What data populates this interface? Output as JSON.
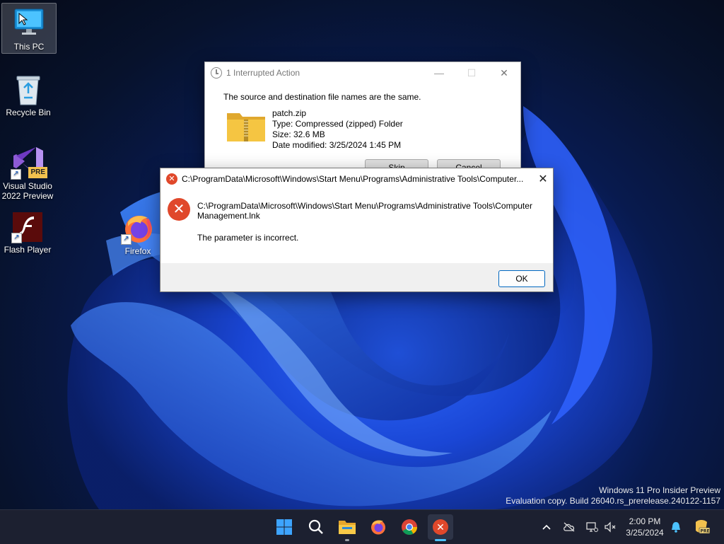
{
  "desktop": {
    "icons": [
      {
        "label": "This PC"
      },
      {
        "label": "Recycle Bin"
      },
      {
        "label": "Visual Studio 2022 Preview",
        "badge": "PRE"
      },
      {
        "label": "Flash Player"
      },
      {
        "label": "Firefox"
      }
    ],
    "watermark": {
      "line1": "Windows 11 Pro Insider Preview",
      "line2": "Evaluation copy. Build 26040.rs_prerelease.240122-1157"
    }
  },
  "interrupted_dialog": {
    "title": "1 Interrupted Action",
    "message": "The source and destination file names are the same.",
    "file_name": "patch.zip",
    "file_type": "Type: Compressed (zipped) Folder",
    "file_size": "Size: 32.6 MB",
    "file_date": "Date modified: 3/25/2024 1:45 PM",
    "skip_label": "Skip",
    "cancel_label": "Cancel"
  },
  "error_dialog": {
    "title": "C:\\ProgramData\\Microsoft\\Windows\\Start Menu\\Programs\\Administrative Tools\\Computer...",
    "path_line1": "C:\\ProgramData\\Microsoft\\Windows\\Start Menu\\Programs\\Administrative Tools\\Computer",
    "path_line2": "Management.lnk",
    "message": "The parameter is incorrect.",
    "ok_label": "OK"
  },
  "taskbar": {
    "apps": [
      "start-icon",
      "search-icon",
      "file-explorer-icon",
      "firefox-icon",
      "chrome-icon",
      "error-app-icon"
    ],
    "clock_time": "2:00 PM",
    "clock_date": "3/25/2024",
    "accent": "#0078d4"
  },
  "colors": {
    "error_red": "#e0482b",
    "folder_yellow": "#f5c542"
  }
}
